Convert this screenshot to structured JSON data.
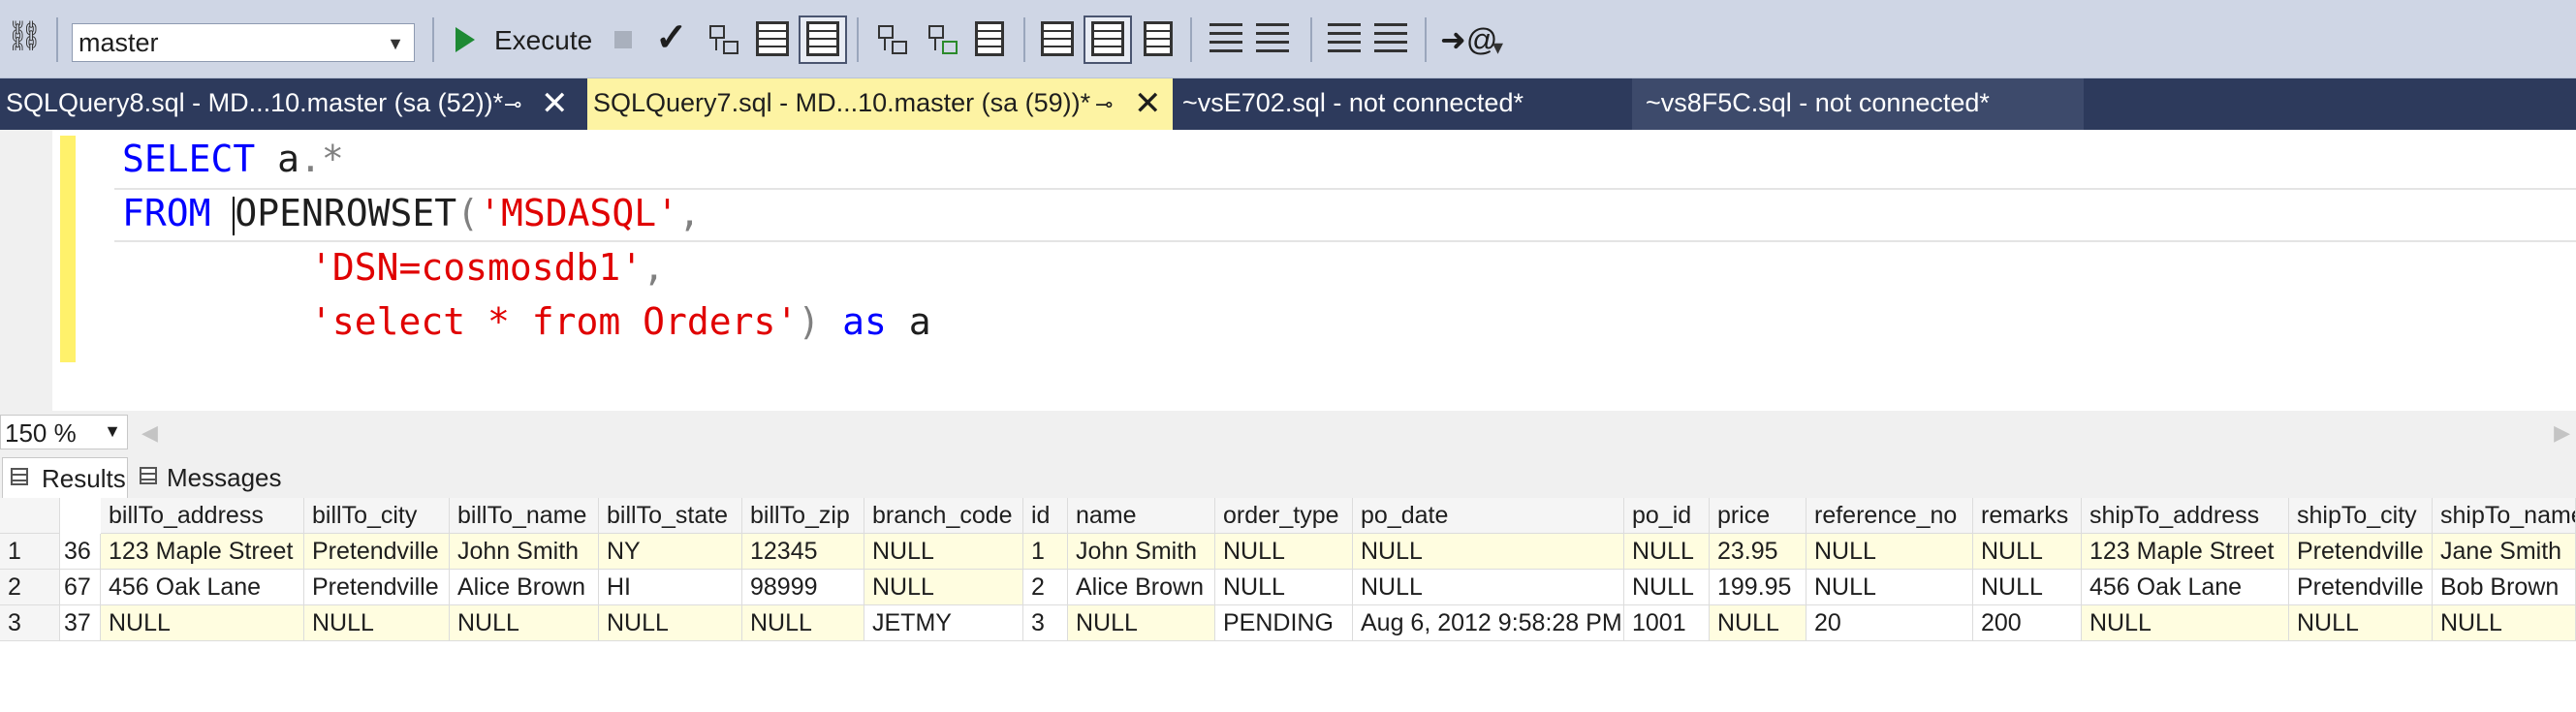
{
  "toolbar": {
    "database": "master",
    "execute_label": "Execute"
  },
  "tabs": [
    {
      "label": "SQLQuery8.sql - MD...10.master (sa (52))*",
      "pin": "⊸",
      "close": "✕"
    },
    {
      "label": "SQLQuery7.sql - MD...10.master (sa (59))*",
      "pin": "⊸",
      "close": "✕"
    },
    {
      "label": "~vsE702.sql - not connected*"
    },
    {
      "label": "~vs8F5C.sql - not connected*"
    }
  ],
  "editor": {
    "l1": {
      "kw1": "SELECT",
      "t1": " a",
      "op1": ".*"
    },
    "l2": {
      "kw1": "FROM",
      "t1": " ",
      "t2": "OPENROWSET",
      "op1": "(",
      "s1": "'MSDASQL'",
      "op2": ","
    },
    "l3": {
      "s1": "'DSN=cosmosdb1'",
      "op1": ","
    },
    "l4": {
      "s1": "'select * from Orders'",
      "op1": ")",
      "kw1": " as",
      "t1": " a"
    }
  },
  "zoom": "150 %",
  "result_tabs": {
    "results": "Results",
    "messages": "Messages"
  },
  "grid": {
    "columns": [
      "",
      "billTo_address",
      "billTo_city",
      "billTo_name",
      "billTo_state",
      "billTo_zip",
      "branch_code",
      "id",
      "name",
      "order_type",
      "po_date",
      "po_id",
      "price",
      "reference_no",
      "remarks",
      "shipTo_address",
      "shipTo_city",
      "shipTo_name"
    ],
    "rows": [
      [
        "1",
        "36",
        "123 Maple Street",
        "Pretendville",
        "John Smith",
        "NY",
        "12345",
        "NULL",
        "1",
        "John Smith",
        "NULL",
        "NULL",
        "NULL",
        "23.95",
        "NULL",
        "NULL",
        "123 Maple Street",
        "Pretendville",
        "Jane Smith"
      ],
      [
        "2",
        "67",
        "456 Oak Lane",
        "Pretendville",
        "Alice Brown",
        "HI",
        "98999",
        "NULL",
        "2",
        "Alice Brown",
        "NULL",
        "NULL",
        "NULL",
        "199.95",
        "NULL",
        "NULL",
        "456 Oak Lane",
        "Pretendville",
        "Bob Brown"
      ],
      [
        "3",
        "37",
        "NULL",
        "NULL",
        "NULL",
        "NULL",
        "NULL",
        "JETMY",
        "3",
        "NULL",
        "PENDING",
        "Aug 6, 2012 9:58:28 PM",
        "1001",
        "NULL",
        "20",
        "200",
        "NULL",
        "NULL",
        "NULL"
      ]
    ]
  },
  "colors": {
    "active_tab": "#fdf3a3",
    "tab_bar": "#2d3a5c",
    "keyword": "#0000ff",
    "string": "#e00000"
  }
}
